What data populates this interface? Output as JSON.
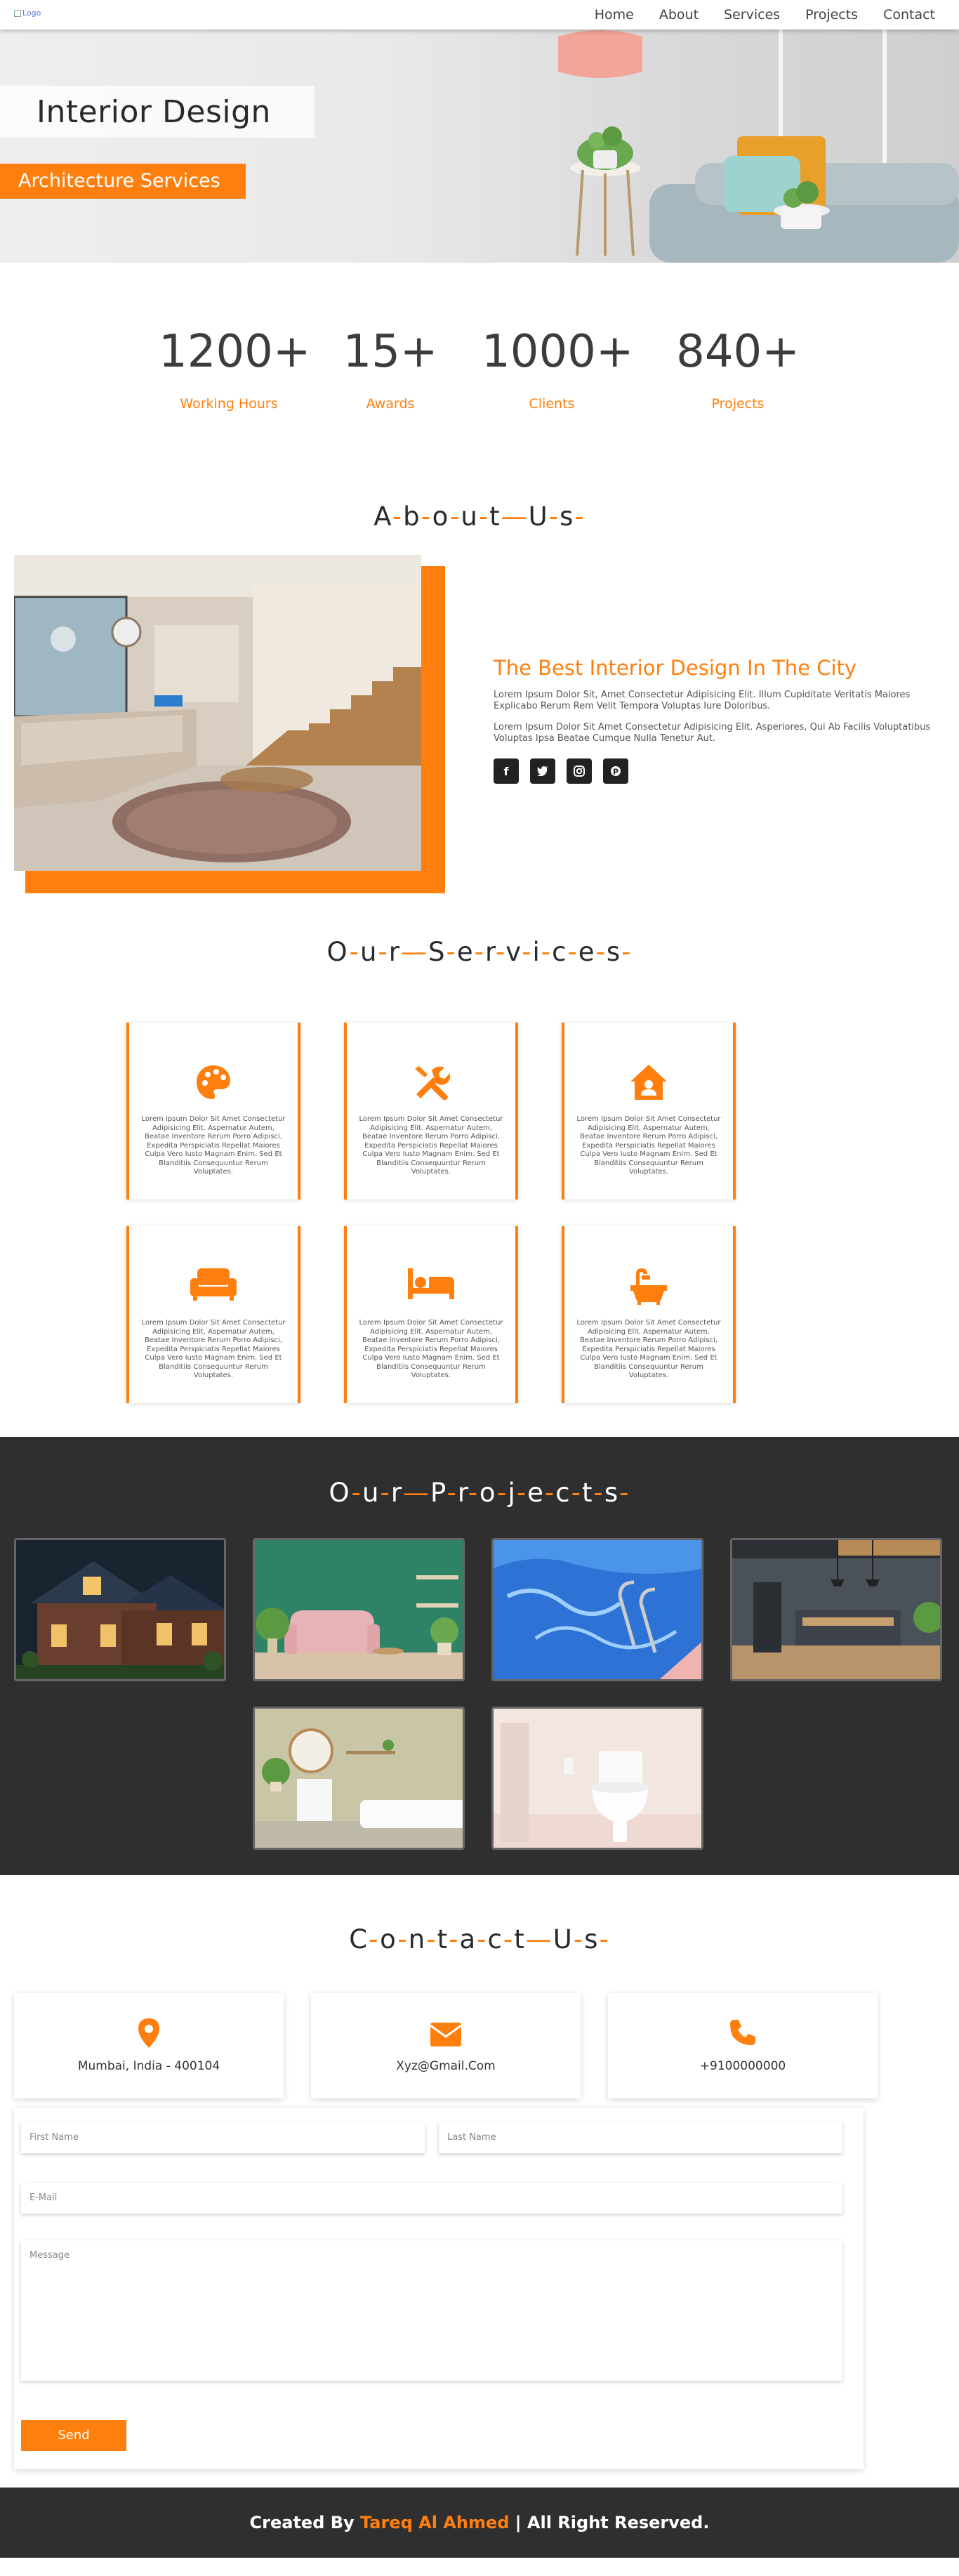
{
  "nav": {
    "logo_alt": "Logo",
    "links": [
      "Home",
      "About",
      "Services",
      "Projects",
      "Contact"
    ]
  },
  "hero": {
    "title": "Interior Design",
    "subtitle": "Architecture Services"
  },
  "stats": [
    {
      "value": "1200+",
      "label": "Working Hours"
    },
    {
      "value": "15+",
      "label": "Awards"
    },
    {
      "value": "1000+",
      "label": "Clients"
    },
    {
      "value": "840+",
      "label": "Projects"
    }
  ],
  "about": {
    "heading_letters": [
      "A",
      "b",
      "o",
      "u",
      "t",
      "U",
      "s"
    ],
    "heading_words": [
      [
        "A",
        "b",
        "o",
        "u",
        "t"
      ],
      [
        "U",
        "s"
      ]
    ],
    "title": "The Best Interior Design In The City",
    "paragraphs": [
      "Lorem Ipsum Dolor Sit, Amet Consectetur Adipisicing Elit. Illum Cupiditate Veritatis Maiores Explicabo Rerum Rem Velit Tempora Voluptas Iure Doloribus.",
      "Lorem Ipsum Dolor Sit Amet Consectetur Adipisicing Elit. Asperiores, Qui Ab Facilis Voluptatibus Voluptas Ipsa Beatae Cumque Nulla Tenetur Aut."
    ],
    "socials": [
      "facebook-icon",
      "twitter-icon",
      "instagram-icon",
      "pinterest-icon"
    ]
  },
  "services": {
    "heading_words": [
      [
        "O",
        "u",
        "r"
      ],
      [
        "S",
        "e",
        "r",
        "v",
        "i",
        "c",
        "e",
        "s"
      ]
    ],
    "cards": [
      {
        "icon": "palette-icon",
        "text": "Lorem Ipsum Dolor Sit Amet Consectetur Adipisicing Elit. Aspernatur Autem, Beatae Inventore Rerum Porro Adipisci, Expedita Perspiciatis Repellat Maiores Culpa Vero Iusto Magnam Enim. Sed Et Blanditiis Consequuntur Rerum Voluptates."
      },
      {
        "icon": "tools-icon",
        "text": "Lorem Ipsum Dolor Sit Amet Consectetur Adipisicing Elit. Aspernatur Autem, Beatae Inventore Rerum Porro Adipisci, Expedita Perspiciatis Repellat Maiores Culpa Vero Iusto Magnam Enim. Sed Et Blanditiis Consequuntur Rerum Voluptates."
      },
      {
        "icon": "house-user-icon",
        "text": "Lorem Ipsum Dolor Sit Amet Consectetur Adipisicing Elit. Aspernatur Autem, Beatae Inventore Rerum Porro Adipisci, Expedita Perspiciatis Repellat Maiores Culpa Vero Iusto Magnam Enim. Sed Et Blanditiis Consequuntur Rerum Voluptates."
      },
      {
        "icon": "couch-icon",
        "text": "Lorem Ipsum Dolor Sit Amet Consectetur Adipisicing Elit. Aspernatur Autem, Beatae Inventore Rerum Porro Adipisci, Expedita Perspiciatis Repellat Maiores Culpa Vero Iusto Magnam Enim. Sed Et Blanditiis Consequuntur Rerum Voluptates."
      },
      {
        "icon": "bed-icon",
        "text": "Lorem Ipsum Dolor Sit Amet Consectetur Adipisicing Elit. Aspernatur Autem, Beatae Inventore Rerum Porro Adipisci, Expedita Perspiciatis Repellat Maiores Culpa Vero Iusto Magnam Enim. Sed Et Blanditiis Consequuntur Rerum Voluptates."
      },
      {
        "icon": "bath-icon",
        "text": "Lorem Ipsum Dolor Sit Amet Consectetur Adipisicing Elit. Aspernatur Autem, Beatae Inventore Rerum Porro Adipisci, Expedita Perspiciatis Repellat Maiores Culpa Vero Iusto Magnam Enim. Sed Et Blanditiis Consequuntur Rerum Voluptates."
      }
    ]
  },
  "projects": {
    "heading_words": [
      [
        "O",
        "u",
        "r"
      ],
      [
        "P",
        "r",
        "o",
        "j",
        "e",
        "c",
        "t",
        "s"
      ]
    ],
    "images": [
      "house-exterior-photo",
      "living-room-photo",
      "swimming-pool-photo",
      "kitchen-photo",
      "bathroom-shelf-photo",
      "toilet-photo"
    ]
  },
  "contact": {
    "heading_words": [
      [
        "C",
        "o",
        "n",
        "t",
        "a",
        "c",
        "t"
      ],
      [
        "U",
        "s"
      ]
    ],
    "cards": [
      {
        "icon": "location-pin-icon",
        "text": "Mumbai, India - 400104"
      },
      {
        "icon": "envelope-icon",
        "text": "Xyz@Gmail.Com"
      },
      {
        "icon": "phone-icon",
        "text": "+9100000000"
      }
    ],
    "form": {
      "first_name_placeholder": "First Name",
      "last_name_placeholder": "Last Name",
      "email_placeholder": "E-Mail",
      "message_placeholder": "Message",
      "send_label": "Send"
    }
  },
  "footer": {
    "prefix": "Created By",
    "name": "Tareq Al Ahmed",
    "suffix": "| All Right Reserved."
  },
  "colors": {
    "accent": "#ff7f0e",
    "dark": "#2f2f2f"
  }
}
